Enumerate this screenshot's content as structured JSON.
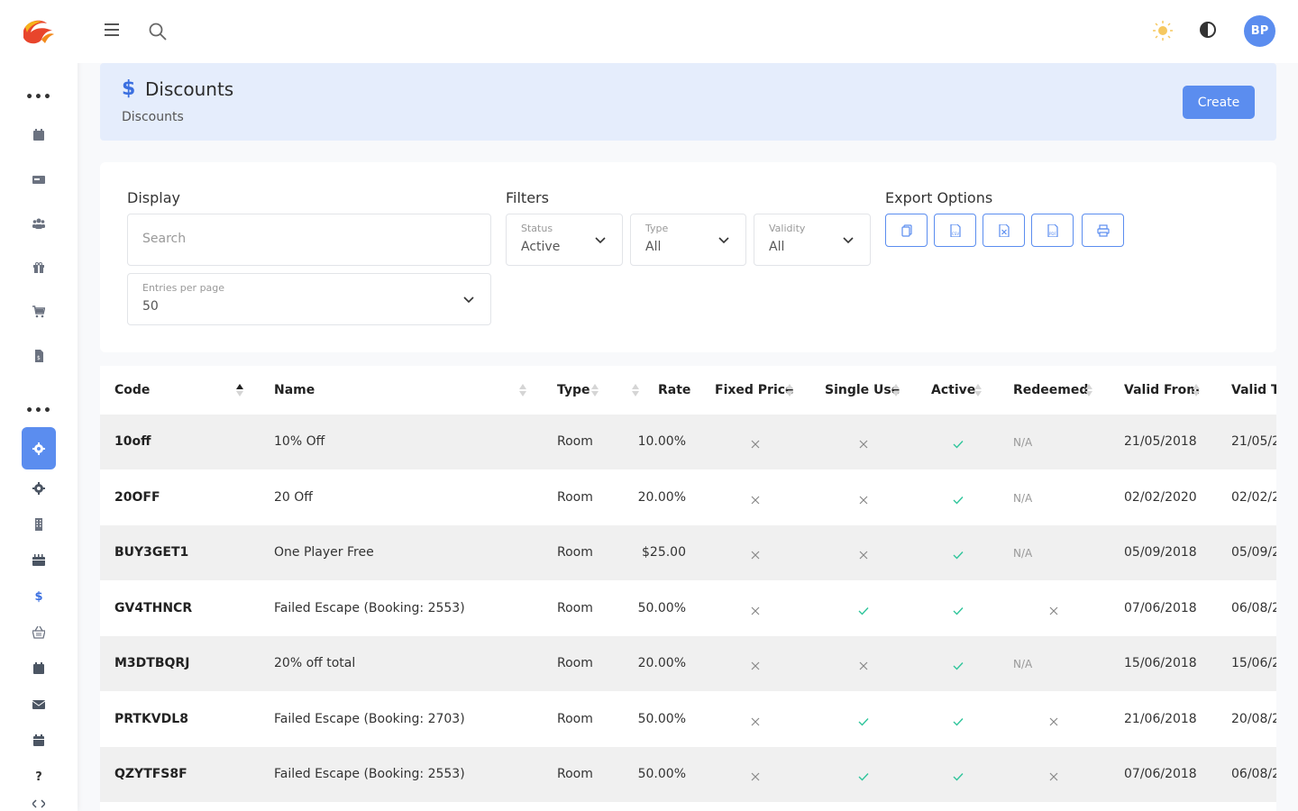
{
  "header": {
    "title": "Discounts",
    "breadcrumb": "Discounts",
    "create_label": "Create",
    "avatar_initials": "BP"
  },
  "display": {
    "title": "Display",
    "search_placeholder": "Search",
    "entries_label": "Entries per page",
    "entries_value": "50"
  },
  "filters": {
    "title": "Filters",
    "status": {
      "label": "Status",
      "value": "Active"
    },
    "type": {
      "label": "Type",
      "value": "All"
    },
    "validity": {
      "label": "Validity",
      "value": "All"
    }
  },
  "export": {
    "title": "Export Options",
    "buttons": [
      "copy-icon",
      "csv-icon",
      "excel-icon",
      "pdf-icon",
      "print-icon"
    ]
  },
  "table": {
    "columns": [
      "Code",
      "Name",
      "Type",
      "Rate",
      "Fixed Price",
      "Single Use",
      "Active",
      "Redeemed",
      "Valid From",
      "Valid To"
    ],
    "rows": [
      {
        "code": "10off",
        "name": "10% Off",
        "type": "Room",
        "rate": "10.00%",
        "fixed": "x",
        "single": "x",
        "active": "check",
        "redeemed": "N/A",
        "from": "21/05/2018",
        "to": "21/05/2"
      },
      {
        "code": "20OFF",
        "name": "20 Off",
        "type": "Room",
        "rate": "20.00%",
        "fixed": "x",
        "single": "x",
        "active": "check",
        "redeemed": "N/A",
        "from": "02/02/2020",
        "to": "02/02/2"
      },
      {
        "code": "BUY3GET1",
        "name": "One Player Free",
        "type": "Room",
        "rate": "$25.00",
        "fixed": "x",
        "single": "x",
        "active": "check",
        "redeemed": "N/A",
        "from": "05/09/2018",
        "to": "05/09/2"
      },
      {
        "code": "GV4THNCR",
        "name": "Failed Escape (Booking: 2553)",
        "type": "Room",
        "rate": "50.00%",
        "fixed": "x",
        "single": "check",
        "active": "check",
        "redeemed": "x",
        "from": "07/06/2018",
        "to": "06/08/2"
      },
      {
        "code": "M3DTBQRJ",
        "name": "20% off total",
        "type": "Room",
        "rate": "20.00%",
        "fixed": "x",
        "single": "x",
        "active": "check",
        "redeemed": "N/A",
        "from": "15/06/2018",
        "to": "15/06/2"
      },
      {
        "code": "PRTKVDL8",
        "name": "Failed Escape (Booking: 2703)",
        "type": "Room",
        "rate": "50.00%",
        "fixed": "x",
        "single": "check",
        "active": "check",
        "redeemed": "x",
        "from": "21/06/2018",
        "to": "20/08/2"
      },
      {
        "code": "QZYTFS8F",
        "name": "Failed Escape (Booking: 2553)",
        "type": "Room",
        "rate": "50.00%",
        "fixed": "x",
        "single": "check",
        "active": "check",
        "redeemed": "x",
        "from": "07/06/2018",
        "to": "06/08/2"
      }
    ]
  },
  "colors": {
    "accent": "#5b8def",
    "banner": "#e5edfc",
    "check": "#2fc59b",
    "cross": "#888888"
  }
}
